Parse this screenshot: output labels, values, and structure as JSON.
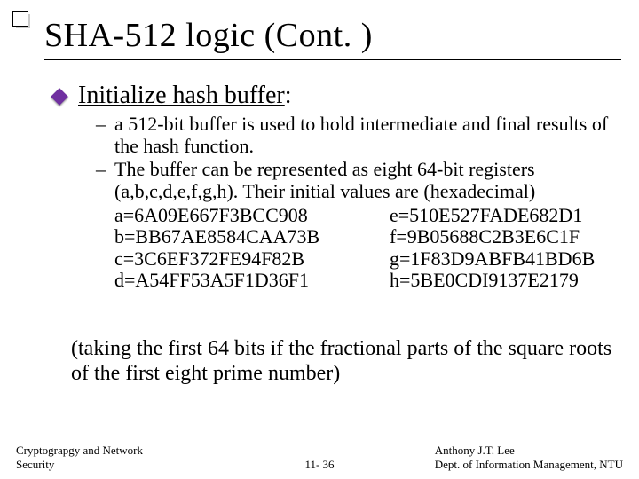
{
  "title": "SHA-512 logic (Cont. )",
  "heading_underlined": "Initialize hash buffer",
  "heading_suffix": ":",
  "bullets": [
    "a 512-bit buffer is used to hold intermediate and final results of the hash function.",
    "The buffer can be represented as eight 64-bit registers (a,b,c,d,e,f,g,h). Their initial values are (hexadecimal)"
  ],
  "hex": {
    "a": "a=6A09E667F3BCC908",
    "b": "b=BB67AE8584CAA73B",
    "c": "c=3C6EF372FE94F82B",
    "d": "d=A54FF53A5F1D36F1",
    "e": "e=510E527FADE682D1",
    "f": "f=9B05688C2B3E6C1F",
    "g": "g=1F83D9ABFB41BD6B",
    "h": "h=5BE0CDI9137E2179"
  },
  "note": "(taking the first 64 bits if the fractional parts of the square roots of the first eight prime number)",
  "footer": {
    "left_line1": "Cryptograpgy and Network",
    "left_line2": "Security",
    "center": "11- 36",
    "right_line1": "Anthony J.T. Lee",
    "right_line2": "Dept. of Information Management, NTU"
  }
}
